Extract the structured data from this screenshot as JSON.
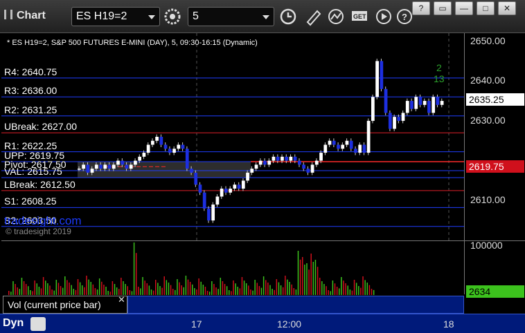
{
  "window": {
    "title": "Chart",
    "symbol_value": "ES H19=2",
    "interval_value": "5",
    "controls": [
      "?",
      "▭",
      "—",
      "□",
      "✕"
    ]
  },
  "chart": {
    "subtitle": "* ES H19=2, S&P 500 FUTURES E-MINI (DAY), 5, 09:30-16:15 (Dynamic)",
    "watermark": "tradesight.com",
    "watermark_sub": "© tradesight 2019",
    "levels": [
      {
        "label": "R4: 2640.75",
        "price": 2640.75,
        "color": "#1f3dff"
      },
      {
        "label": "R3: 2636.00",
        "price": 2636.0,
        "color": "#1f3dff"
      },
      {
        "label": "R2: 2631.25",
        "price": 2631.25,
        "color": "#1f3dff"
      },
      {
        "label": "UBreak: 2627.00",
        "price": 2627.0,
        "color": "#e0202a"
      },
      {
        "label": "R1: 2622.25",
        "price": 2622.25,
        "color": "#1f3dff"
      },
      {
        "label": "UPP: 2619.75",
        "price": 2619.75,
        "color": "#1f3dff"
      },
      {
        "label": "Pivot: 2617.50",
        "price": 2617.5,
        "color": "#1f3dff"
      },
      {
        "label": "VAL: 2615.75",
        "price": 2615.75,
        "color": "#1f3dff"
      },
      {
        "label": "LBreak: 2612.50",
        "price": 2612.5,
        "color": "#e0202a"
      },
      {
        "label": "S1: 2608.25",
        "price": 2608.25,
        "color": "#1f3dff"
      },
      {
        "label": "S2: 2603.50",
        "price": 2603.5,
        "color": "#1f3dff"
      }
    ],
    "y_ticks": [
      "2650.00",
      "2640.00",
      "2630.00",
      "2610.00"
    ],
    "y_tick_values": [
      2650,
      2640,
      2630,
      2610
    ],
    "last_price": "2635.25",
    "red_price": "2619.75",
    "annotations": {
      "top": "2",
      "bottom": "13"
    },
    "x_ticks": [
      "17",
      "12:00",
      "18"
    ]
  },
  "volume": {
    "panel_label": "Vol (current price bar)",
    "close_icon": "close-icon",
    "y_tick": "100000",
    "last_value": "2634"
  },
  "status": {
    "mode": "Dyn"
  },
  "chart_data": {
    "type": "candlestick",
    "price_range": [
      2600,
      2652
    ],
    "closes": [
      2618,
      2619,
      2617,
      2618,
      2619,
      2618,
      2619,
      2618,
      2619,
      2620,
      2619,
      2618,
      2619,
      2620,
      2621,
      2622,
      2624,
      2625,
      2626,
      2624,
      2623,
      2622,
      2623,
      2624,
      2623,
      2618,
      2617,
      2614,
      2612,
      2608,
      2605,
      2609,
      2611,
      2613,
      2612,
      2613,
      2614,
      2613,
      2615,
      2617,
      2618,
      2619,
      2620,
      2619,
      2620,
      2621,
      2620,
      2621,
      2620,
      2621,
      2620,
      2619,
      2618,
      2617,
      2619,
      2620,
      2622,
      2624,
      2625,
      2624,
      2623,
      2624,
      2625,
      2623,
      2622,
      2624,
      2622,
      2630,
      2636,
      2645,
      2638,
      2632,
      2628,
      2631,
      2630,
      2632,
      2635,
      2633,
      2636,
      2634,
      2635,
      2632,
      2636,
      2634,
      2635
    ]
  }
}
